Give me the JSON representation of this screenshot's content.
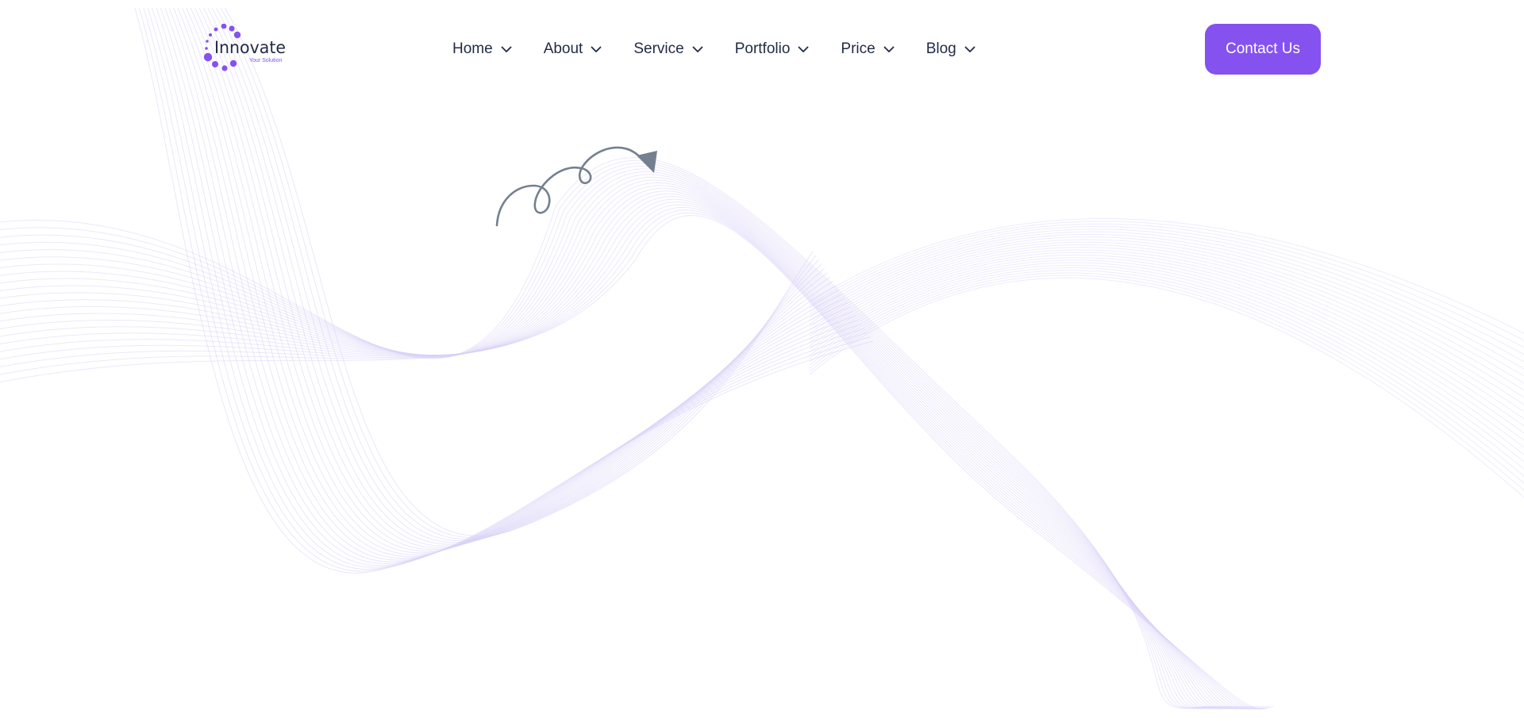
{
  "brand": {
    "name": "Innovate",
    "tagline": "Your Solution"
  },
  "nav": {
    "items": [
      {
        "label": "Home"
      },
      {
        "label": "About"
      },
      {
        "label": "Service"
      },
      {
        "label": "Portfolio"
      },
      {
        "label": "Price"
      },
      {
        "label": "Blog"
      }
    ]
  },
  "cta": {
    "label": "Contact Us"
  },
  "colors": {
    "accent": "#8552f0",
    "nav_text": "#1f2a44",
    "arrow": "#74808f",
    "wave_lines": "#d9d2f7"
  },
  "icons": {
    "dropdown": "chevron-down-icon",
    "doodle": "curly-arrow-icon",
    "logo_mark": "dotted-circle-icon"
  }
}
